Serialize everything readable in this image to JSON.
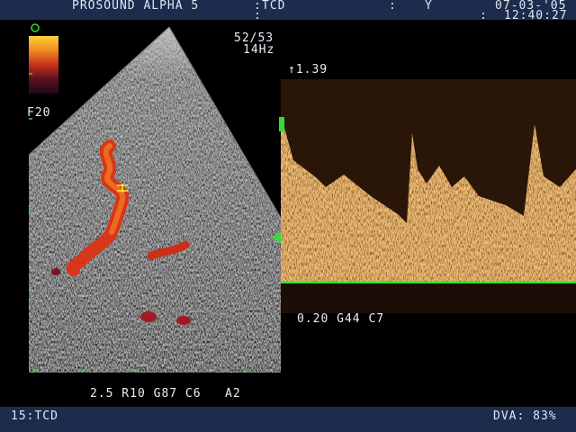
{
  "header": {
    "system_name": "PROSOUND ALPHA 5",
    "mode_colon": ":",
    "mode": "TCD",
    "mode_sub": ":",
    "colon2": ":",
    "field_y": "Y",
    "date": "07-03-'05",
    "time_colon": ":",
    "time": "12:40:27"
  },
  "image_params": {
    "frame_counter": "52/53",
    "frame_rate": "14Hz",
    "focus_label": "F20",
    "velocity_scale": "↑1.39",
    "doppler_params": "0.20 G44 C7",
    "bmode_params": "2.5 R10 G87 C6   A2"
  },
  "footer": {
    "preset": "15:TCD",
    "dva": "DVA: 83%"
  },
  "colors": {
    "bar_bg": "#1d2b4c",
    "flow_red": "#d8361a",
    "doppler_orange": "#c98a3a",
    "baseline_green": "#2ee02e",
    "text": "#dfe7f3"
  },
  "icons": {
    "status_circle": "green-circle-icon",
    "baseline_marker": "green-triangle-icon",
    "gate_marker": "sample-volume-icon"
  }
}
